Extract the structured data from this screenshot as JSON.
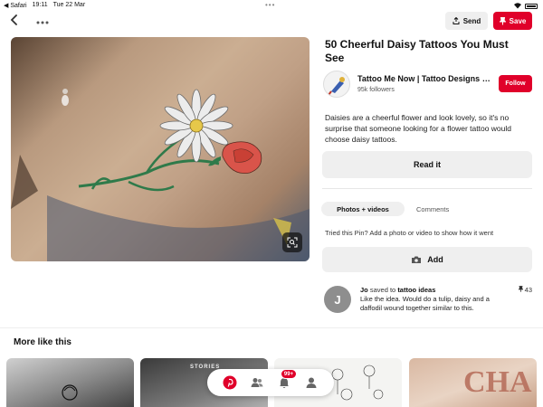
{
  "status_bar": {
    "app": "◀ Safari",
    "time": "19:11",
    "date": "Tue 22 Mar",
    "dots": "•••"
  },
  "toolbar": {
    "send_label": "Send",
    "save_label": "Save"
  },
  "pin": {
    "title": "50 Cheerful Daisy Tattoos You Must See",
    "creator_name": "Tattoo Me Now | Tattoo Designs & ...",
    "followers": "95k followers",
    "follow_label": "Follow",
    "description": "Daisies are a cheerful flower and look lovely, so it's no surprise that someone looking for a flower tattoo would choose daisy tattoos.",
    "read_label": "Read it"
  },
  "tabs": {
    "photos_videos": "Photos + videos",
    "comments": "Comments"
  },
  "tried": {
    "text": "Tried this Pin? Add a photo or video to show how it went",
    "add_label": "Add"
  },
  "comment": {
    "avatar_letter": "J",
    "user": "Jo",
    "saved_text": "saved to",
    "board": "tattoo ideas",
    "body": "Like the idea. Would do a tulip, daisy and a daffodil wound together similar to this.",
    "saves": "43"
  },
  "more_like_this": "More like this",
  "thumbs": {
    "thumb2_text": "STORIES",
    "thumb4_text": "CHA"
  },
  "nav": {
    "notifications_badge": "99+"
  },
  "colors": {
    "brand_red": "#e0002a",
    "button_gray": "#efefef"
  }
}
